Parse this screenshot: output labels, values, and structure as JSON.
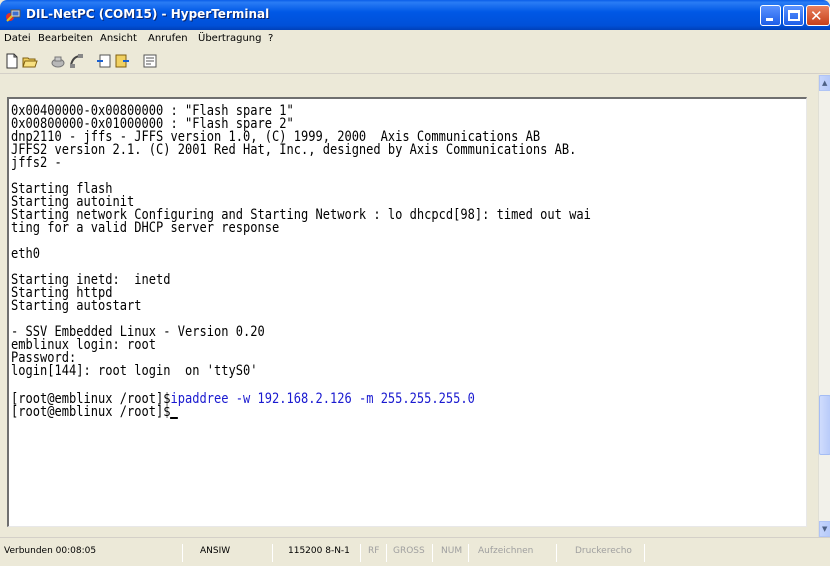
{
  "window": {
    "title": "DIL-NetPC (COM15) - HyperTerminal",
    "app_icon": "hyperterminal-icon"
  },
  "menu": {
    "items": [
      {
        "label": "Datei"
      },
      {
        "label": "Bearbeiten"
      },
      {
        "label": "Ansicht"
      },
      {
        "label": "Anrufen"
      },
      {
        "label": "Übertragung"
      },
      {
        "label": "?"
      }
    ]
  },
  "toolbar": {
    "icons": [
      "new-icon",
      "open-icon",
      "connect-icon",
      "disconnect-icon",
      "send-icon",
      "receive-icon",
      "properties-icon"
    ]
  },
  "terminal": {
    "lines": [
      "0x00400000-0x00800000 : \"Flash spare 1\"",
      "0x00800000-0x01000000 : \"Flash spare 2\"",
      "dnp2110 - jffs - JFFS version 1.0, (C) 1999, 2000  Axis Communications AB",
      "JFFS2 version 2.1. (C) 2001 Red Hat, Inc., designed by Axis Communications AB.",
      "jffs2 -",
      "",
      "Starting flash",
      "Starting autoinit",
      "Starting network Configuring and Starting Network : lo dhcpcd[98]: timed out wai",
      "ting for a valid DHCP server response",
      "",
      "eth0",
      "",
      "Starting inetd:  inetd",
      "Starting httpd",
      "Starting autostart",
      "",
      "- SSV Embedded Linux - Version 0.20",
      "emblinux login: root",
      "Password:",
      "login[144]: root login  on 'ttyS0'",
      ""
    ],
    "prompt1": "[root@emblinux /root]$",
    "command1": "ipaddree -w 192.168.2.126 -m 255.255.255.0",
    "prompt2": "[root@emblinux /root]$",
    "command_color": "#1a1ad0"
  },
  "status": {
    "connected": "Verbunden 00:08:05",
    "emulation": "ANSIW",
    "settings": "115200 8-N-1",
    "scroll": "RF",
    "caps": "GROSS",
    "num": "NUM",
    "capture": "Aufzeichnen",
    "print_echo": "Druckerecho"
  },
  "colors": {
    "titlebar": "#0058e6",
    "close_button": "#c6401a",
    "window_face": "#ece9d8"
  }
}
